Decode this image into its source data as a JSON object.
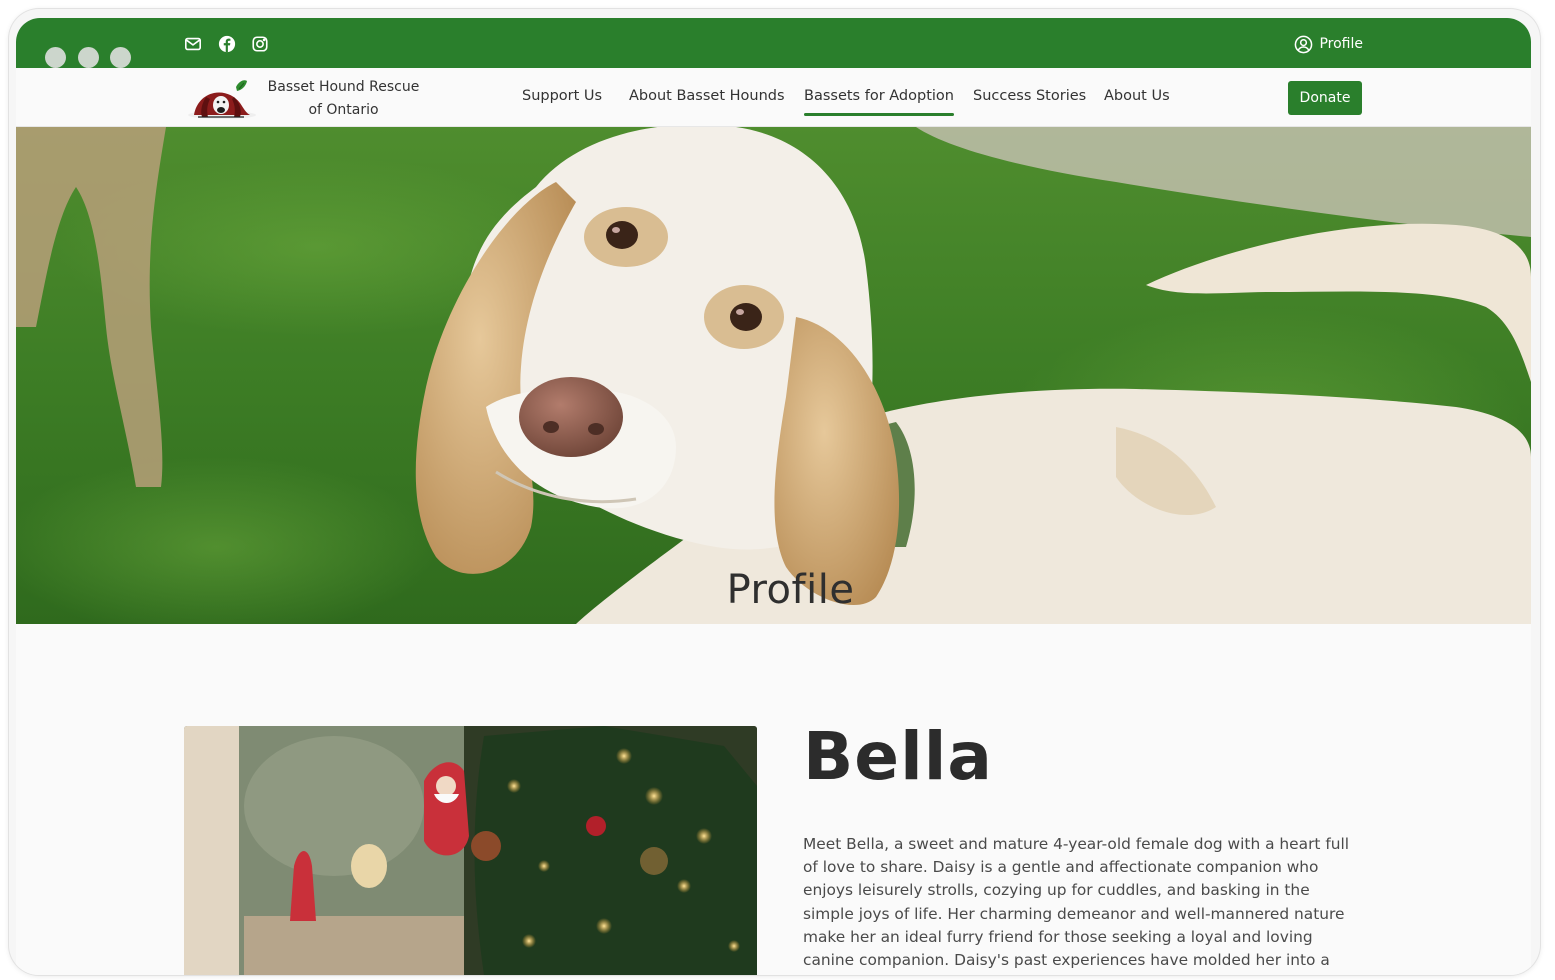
{
  "topbar": {
    "social_icons": [
      "mail-icon",
      "facebook-icon",
      "instagram-icon"
    ],
    "profile_label": "Profile",
    "background_color": "#2a7f2c"
  },
  "brand": {
    "line1": "Basset Hound Rescue",
    "line2": "of Ontario"
  },
  "nav": {
    "items": [
      {
        "label": "Support Us",
        "active": false
      },
      {
        "label": "About Basset Hounds",
        "active": false
      },
      {
        "label": "Bassets for Adoption",
        "active": true
      },
      {
        "label": "Success Stories",
        "active": false
      },
      {
        "label": "About Us",
        "active": false
      }
    ],
    "donate_label": "Donate"
  },
  "hero": {
    "heading": "Profile"
  },
  "dog": {
    "name": "Bella",
    "bio": "Meet Bella, a sweet and mature 4-year-old female dog with a heart full of love to share. Daisy is a gentle and affectionate companion who enjoys leisurely strolls, cozying up for cuddles, and basking in the simple joys of life. Her charming demeanor and well-mannered nature make her an ideal furry friend for those seeking a loyal and loving canine companion. Daisy's past experiences have molded her into a well-behaved and adaptable"
  },
  "colors": {
    "accent": "#2a7f2c",
    "page_background": "#fafafa"
  }
}
